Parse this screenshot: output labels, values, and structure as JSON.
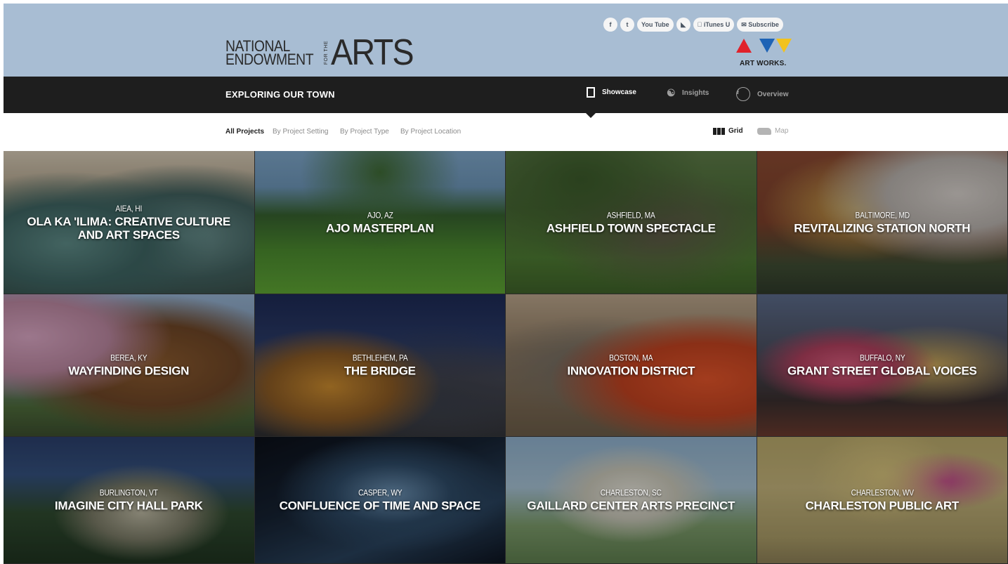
{
  "header": {
    "logo": {
      "line1": "NATIONAL",
      "line2": "ENDOWMENT",
      "for_the": "FOR THE",
      "arts": "ARTS"
    },
    "social": {
      "facebook": "f",
      "twitter": "t",
      "youtube": "You Tube",
      "rss": "◣",
      "itunes": " iTunes U",
      "subscribe": "✉ Subscribe"
    },
    "art_works": "ART WORKS.",
    "colors": {
      "red": "#e0222b",
      "blue": "#1e63b5",
      "yellow": "#f2c21d",
      "header_bg": "#a8bdd3"
    }
  },
  "nav": {
    "title": "EXPLORING OUR TOWN",
    "showcase": "Showcase",
    "insights": "Insights",
    "overview": "Overview",
    "overview_icon": "i",
    "bulb_icon": "☃"
  },
  "filters": {
    "all": "All Projects",
    "setting": "By Project Setting",
    "type": "By Project Type",
    "location": "By Project Location",
    "grid": "Grid",
    "map": "Map"
  },
  "tiles": [
    {
      "location": "AIEA, HI",
      "title": "OLA KA 'ILIMA: CREATIVE CULTURE AND ART SPACES"
    },
    {
      "location": "AJO, AZ",
      "title": "AJO MASTERPLAN"
    },
    {
      "location": "ASHFIELD, MA",
      "title": "ASHFIELD TOWN SPECTACLE"
    },
    {
      "location": "BALTIMORE, MD",
      "title": "REVITALIZING STATION NORTH"
    },
    {
      "location": "BEREA, KY",
      "title": "WAYFINDING DESIGN"
    },
    {
      "location": "BETHLEHEM, PA",
      "title": "THE BRIDGE"
    },
    {
      "location": "BOSTON, MA",
      "title": "INNOVATION DISTRICT"
    },
    {
      "location": "BUFFALO, NY",
      "title": "GRANT STREET GLOBAL VOICES"
    },
    {
      "location": "BURLINGTON, VT",
      "title": "IMAGINE CITY HALL PARK"
    },
    {
      "location": "CASPER, WY",
      "title": "CONFLUENCE OF TIME AND SPACE"
    },
    {
      "location": "CHARLESTON, SC",
      "title": "GAILLARD CENTER ARTS PRECINCT"
    },
    {
      "location": "CHARLESTON, WV",
      "title": "CHARLESTON PUBLIC ART"
    }
  ]
}
